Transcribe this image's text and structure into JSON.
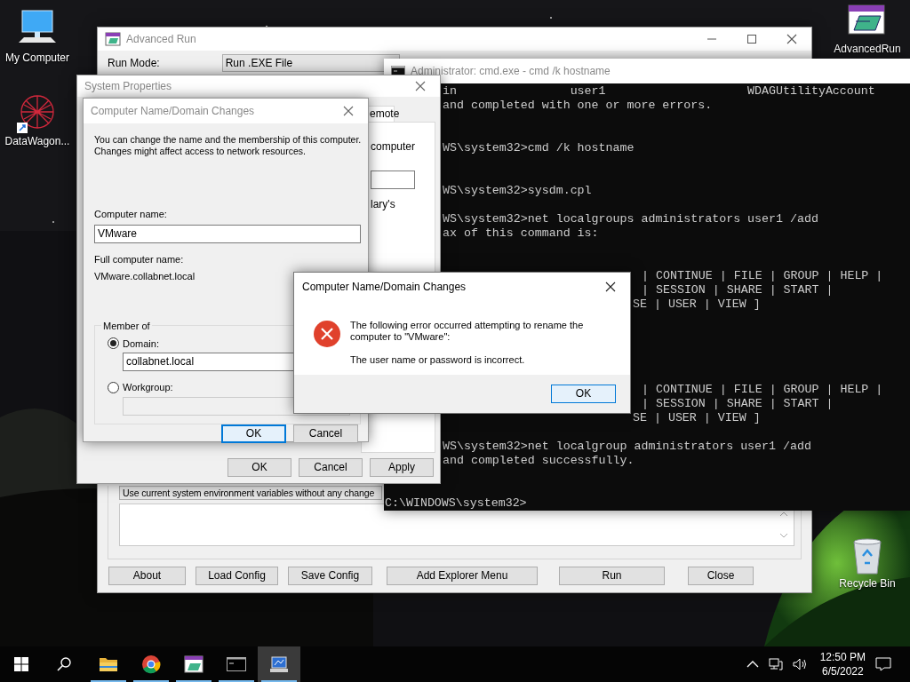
{
  "desktop_icons": [
    {
      "kind": "computer",
      "label": "My Computer"
    },
    {
      "kind": "app",
      "label": "DataWagon..."
    },
    {
      "kind": "advrun",
      "label": "AdvancedRun"
    },
    {
      "kind": "recycle",
      "label": "Recycle Bin"
    }
  ],
  "advanced_run": {
    "title": "Advanced Run",
    "run_mode_label": "Run Mode:",
    "run_mode_value": "Run .EXE File",
    "environment_value": "Use current system environment variables without any change",
    "buttons": [
      "About",
      "Load Config",
      "Save Config",
      "Add Explorer Menu",
      "Run",
      "Close"
    ]
  },
  "console": {
    "title": "Administrator: cmd.exe - cmd  /k hostname",
    "lines": [
      {
        "kind": "left-cut",
        "text": "in                user1                    WDAGUtilityAccount"
      },
      {
        "kind": "left-cut",
        "text": "and completed with one or more errors."
      },
      {
        "kind": "blank"
      },
      {
        "kind": "blank"
      },
      {
        "kind": "left-cut",
        "text": "WS\\system32>cmd /k hostname"
      },
      {
        "kind": "blank"
      },
      {
        "kind": "blank"
      },
      {
        "kind": "left-cut",
        "text": "WS\\system32>sysdm.cpl"
      },
      {
        "kind": "blank"
      },
      {
        "kind": "left-cut",
        "text": "WS\\system32>net localgroups administrators user1 /add"
      },
      {
        "kind": "left-cut",
        "text": "ax of this command is:"
      },
      {
        "kind": "blank"
      },
      {
        "kind": "blank"
      },
      {
        "kind": "mid-cut",
        "text": "| CONTINUE | FILE | GROUP | HELP |"
      },
      {
        "kind": "mid-cut",
        "text": "| SESSION | SHARE | START |"
      },
      {
        "kind": "mid-cut-word",
        "text": "SE | USER | VIEW ]"
      },
      {
        "kind": "blank"
      },
      {
        "kind": "blank"
      },
      {
        "kind": "blank"
      },
      {
        "kind": "blank"
      },
      {
        "kind": "blank"
      },
      {
        "kind": "mid-cut",
        "text": "| CONTINUE | FILE | GROUP | HELP |"
      },
      {
        "kind": "mid-cut",
        "text": "| SESSION | SHARE | START |"
      },
      {
        "kind": "mid-cut-word",
        "text": "SE | USER | VIEW ]"
      },
      {
        "kind": "blank"
      },
      {
        "kind": "left-cut",
        "text": "WS\\system32>net localgroup administrators user1 /add"
      },
      {
        "kind": "left-cut",
        "text": "and completed successfully."
      },
      {
        "kind": "blank"
      },
      {
        "kind": "blank"
      },
      {
        "kind": "full",
        "text": "C:\\WINDOWS\\system32>"
      }
    ]
  },
  "system_properties": {
    "title": "System Properties",
    "tab": "emote",
    "text_1": "computer",
    "text_2": "lary's",
    "buttons": [
      "OK",
      "Cancel",
      "Apply"
    ]
  },
  "name_dialog": {
    "title": "Computer Name/Domain Changes",
    "description": "You can change the name and the membership of this computer. Changes might affect access to network resources.",
    "computer_name_label": "Computer name:",
    "computer_name": "VMware",
    "full_name_label": "Full computer name:",
    "full_name": "VMware.collabnet.local",
    "group_label": "Member of",
    "options": [
      {
        "label": "Domain:",
        "selected": true,
        "value": "collabnet.local"
      },
      {
        "label": "Workgroup:",
        "selected": false
      }
    ],
    "buttons": [
      {
        "label": "OK",
        "default": true
      },
      {
        "label": "Cancel",
        "default": false
      }
    ]
  },
  "error_dialog": {
    "title": "Computer Name/Domain Changes",
    "message": "The following error occurred attempting to rename the computer to \"VMware\":",
    "detail": "The user name or password is incorrect.",
    "button": "OK"
  },
  "taskbar": {
    "apps": [
      {
        "kind": "folder",
        "running": true,
        "selected": false
      },
      {
        "kind": "browser",
        "running": true,
        "selected": false
      },
      {
        "kind": "advrun",
        "running": true,
        "selected": false
      },
      {
        "kind": "console",
        "running": true,
        "selected": false
      },
      {
        "kind": "system",
        "running": true,
        "selected": true
      }
    ],
    "time": "12:50 PM",
    "date": "6/5/2022"
  }
}
